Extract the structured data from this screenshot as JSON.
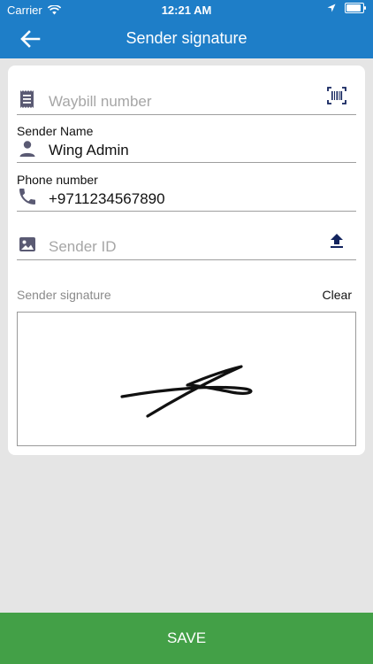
{
  "status_bar": {
    "carrier": "Carrier",
    "time": "12:21 AM"
  },
  "header": {
    "title": "Sender signature",
    "back_icon": "arrow-back-icon"
  },
  "form": {
    "waybill": {
      "placeholder": "Waybill number",
      "icon": "receipt-icon",
      "action_icon": "barcode-scan-icon"
    },
    "sender_name": {
      "label": "Sender Name",
      "value": "Wing Admin",
      "icon": "person-icon"
    },
    "phone": {
      "label": "Phone number",
      "value": "+9711234567890",
      "icon": "phone-icon"
    },
    "sender_id": {
      "placeholder": "Sender ID",
      "icon": "image-icon",
      "action_icon": "upload-icon"
    },
    "signature": {
      "label": "Sender signature",
      "clear_label": "Clear"
    }
  },
  "footer": {
    "save_label": "SAVE"
  },
  "colors": {
    "header": "#1e7ec8",
    "save": "#43a047",
    "background": "#e5e5e5",
    "icon": "#5a5a73"
  }
}
